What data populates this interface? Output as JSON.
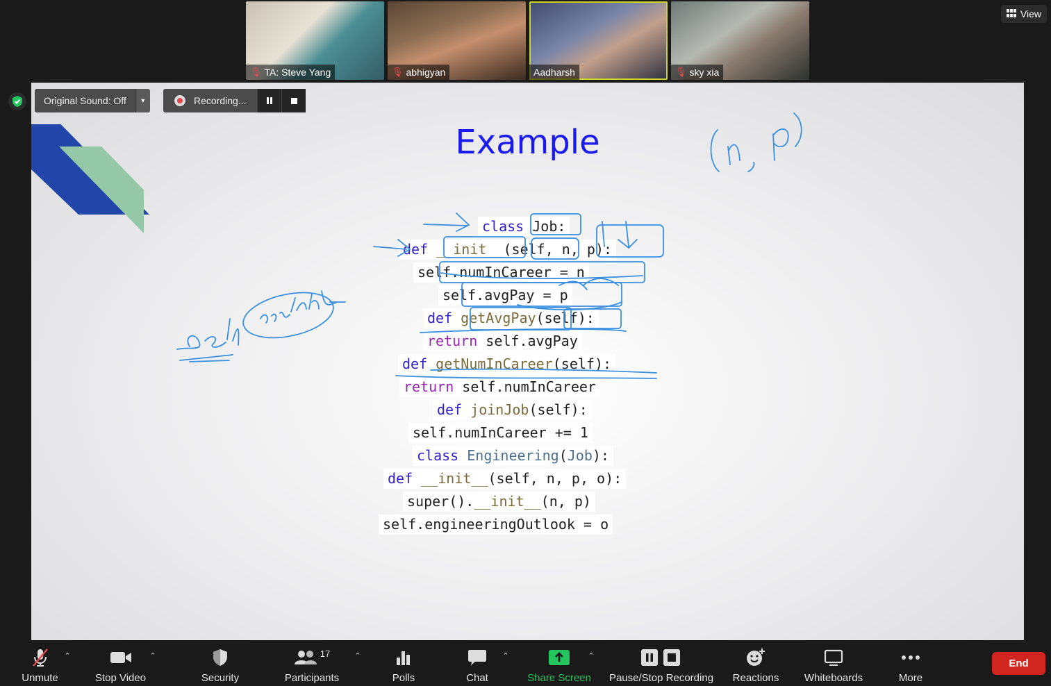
{
  "participants": [
    {
      "name": "TA: Steve Yang",
      "muted": true
    },
    {
      "name": "abhigyan",
      "muted": true
    },
    {
      "name": "Aadharsh",
      "muted": false
    },
    {
      "name": "sky xia",
      "muted": true
    }
  ],
  "view_label": "View",
  "share": {
    "original_sound_label": "Original Sound: Off",
    "recording_label": "Recording...",
    "slide_title": "Example",
    "handwriting": {
      "notes": [
        "(n, p)",
        "self",
        "doesn't",
        "...",
        "do..."
      ]
    }
  },
  "code_lines": [
    [
      {
        "t": "class",
        "c": "kw"
      },
      {
        "t": " Job:",
        "c": ""
      }
    ],
    [
      {
        "t": "def",
        "c": "kw"
      },
      {
        "t": " ",
        "c": ""
      },
      {
        "t": "__init__",
        "c": "fn"
      },
      {
        "t": "(self, n, p):",
        "c": ""
      }
    ],
    [
      {
        "t": "self.numInCareer = n",
        "c": ""
      }
    ],
    [
      {
        "t": "self.avgPay = p",
        "c": ""
      }
    ],
    [
      {
        "t": "def",
        "c": "kw"
      },
      {
        "t": " ",
        "c": ""
      },
      {
        "t": "getAvgPay",
        "c": "fn"
      },
      {
        "t": "(self):",
        "c": ""
      }
    ],
    [
      {
        "t": "return",
        "c": "rt"
      },
      {
        "t": " self.avgPay",
        "c": ""
      }
    ],
    [
      {
        "t": "def",
        "c": "kw"
      },
      {
        "t": " ",
        "c": ""
      },
      {
        "t": "getNumInCareer",
        "c": "fn"
      },
      {
        "t": "(self):",
        "c": ""
      }
    ],
    [
      {
        "t": "return",
        "c": "rt"
      },
      {
        "t": " self.numInCareer",
        "c": ""
      }
    ],
    [
      {
        "t": "def",
        "c": "kw"
      },
      {
        "t": " ",
        "c": ""
      },
      {
        "t": "joinJob",
        "c": "fn"
      },
      {
        "t": "(self):",
        "c": ""
      }
    ],
    [
      {
        "t": "self.numInCareer += 1",
        "c": ""
      }
    ],
    [
      {
        "t": "class",
        "c": "kw"
      },
      {
        "t": " ",
        "c": ""
      },
      {
        "t": "Engineering",
        "c": "cl"
      },
      {
        "t": "(",
        "c": ""
      },
      {
        "t": "Job",
        "c": "cl"
      },
      {
        "t": "):",
        "c": ""
      }
    ],
    [
      {
        "t": "def",
        "c": "kw"
      },
      {
        "t": " ",
        "c": ""
      },
      {
        "t": "__init__",
        "c": "fn"
      },
      {
        "t": "(self, n, p, o):",
        "c": ""
      }
    ],
    [
      {
        "t": "super().",
        "c": ""
      },
      {
        "t": "__init__",
        "c": "fn"
      },
      {
        "t": "(n, p)",
        "c": ""
      }
    ],
    [
      {
        "t": "self.engineeringOutlook = o",
        "c": ""
      }
    ]
  ],
  "toolbar": {
    "unmute": "Unmute",
    "stop_video": "Stop Video",
    "security": "Security",
    "participants": "Participants",
    "participants_count": "17",
    "polls": "Polls",
    "chat": "Chat",
    "share_screen": "Share Screen",
    "pause_stop_recording": "Pause/Stop Recording",
    "reactions": "Reactions",
    "whiteboards": "Whiteboards",
    "more": "More",
    "end": "End"
  },
  "colors": {
    "accent_green": "#22c55e",
    "end_red": "#d0261f",
    "slide_title_blue": "#1a1aee",
    "ink_blue": "#3a8fe0"
  }
}
